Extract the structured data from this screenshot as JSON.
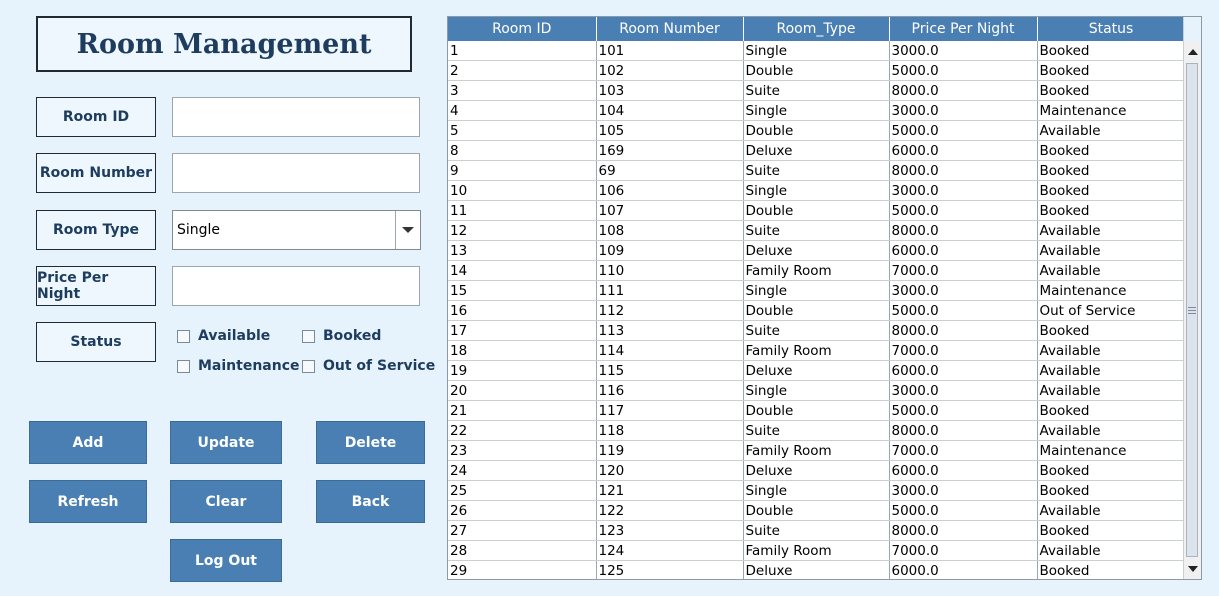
{
  "title": "Room Management",
  "form": {
    "room_id_label": "Room ID",
    "room_number_label": "Room Number",
    "room_type_label": "Room Type",
    "price_label": "Price Per Night",
    "status_label": "Status",
    "room_id_value": "",
    "room_number_value": "",
    "room_type_value": "Single",
    "price_value": "",
    "status_options": {
      "available": "Available",
      "booked": "Booked",
      "maintenance": "Maintenance",
      "out_of_service": "Out of Service"
    }
  },
  "buttons": {
    "add": "Add",
    "update": "Update",
    "delete": "Delete",
    "refresh": "Refresh",
    "clear": "Clear",
    "back": "Back",
    "logout": "Log Out"
  },
  "table": {
    "columns": [
      "Room ID",
      "Room Number",
      "Room_Type",
      "Price Per Night",
      "Status"
    ],
    "rows": [
      [
        "1",
        "101",
        "Single",
        "3000.0",
        "Booked"
      ],
      [
        "2",
        "102",
        "Double",
        "5000.0",
        "Booked"
      ],
      [
        "3",
        "103",
        "Suite",
        "8000.0",
        "Booked"
      ],
      [
        "4",
        "104",
        "Single",
        "3000.0",
        "Maintenance"
      ],
      [
        "5",
        "105",
        "Double",
        "5000.0",
        "Available"
      ],
      [
        "8",
        "169",
        "Deluxe",
        "6000.0",
        "Booked"
      ],
      [
        "9",
        "69",
        "Suite",
        "8000.0",
        "Booked"
      ],
      [
        "10",
        "106",
        "Single",
        "3000.0",
        "Booked"
      ],
      [
        "11",
        "107",
        "Double",
        "5000.0",
        "Booked"
      ],
      [
        "12",
        "108",
        "Suite",
        "8000.0",
        "Available"
      ],
      [
        "13",
        "109",
        "Deluxe",
        "6000.0",
        "Available"
      ],
      [
        "14",
        "110",
        "Family Room",
        "7000.0",
        "Available"
      ],
      [
        "15",
        "111",
        "Single",
        "3000.0",
        "Maintenance"
      ],
      [
        "16",
        "112",
        "Double",
        "5000.0",
        "Out of Service"
      ],
      [
        "17",
        "113",
        "Suite",
        "8000.0",
        "Booked"
      ],
      [
        "18",
        "114",
        "Family Room",
        "7000.0",
        "Available"
      ],
      [
        "19",
        "115",
        "Deluxe",
        "6000.0",
        "Available"
      ],
      [
        "20",
        "116",
        "Single",
        "3000.0",
        "Available"
      ],
      [
        "21",
        "117",
        "Double",
        "5000.0",
        "Booked"
      ],
      [
        "22",
        "118",
        "Suite",
        "8000.0",
        "Available"
      ],
      [
        "23",
        "119",
        "Family Room",
        "7000.0",
        "Maintenance"
      ],
      [
        "24",
        "120",
        "Deluxe",
        "6000.0",
        "Booked"
      ],
      [
        "25",
        "121",
        "Single",
        "3000.0",
        "Booked"
      ],
      [
        "26",
        "122",
        "Double",
        "5000.0",
        "Available"
      ],
      [
        "27",
        "123",
        "Suite",
        "8000.0",
        "Booked"
      ],
      [
        "28",
        "124",
        "Family Room",
        "7000.0",
        "Available"
      ],
      [
        "29",
        "125",
        "Deluxe",
        "6000.0",
        "Booked"
      ]
    ]
  }
}
